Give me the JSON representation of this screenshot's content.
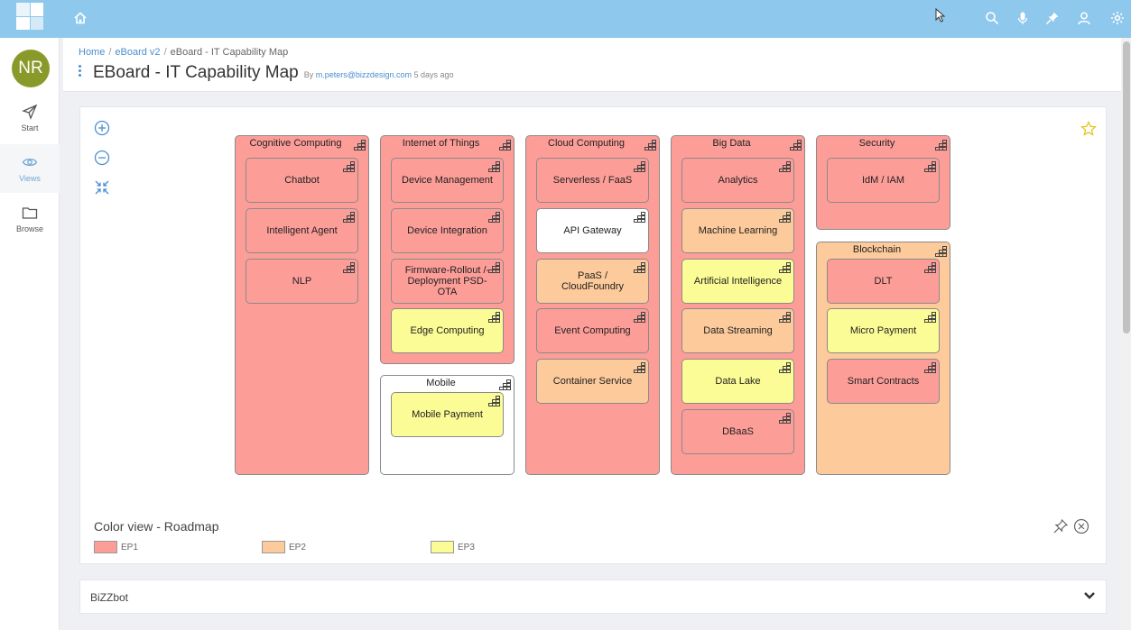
{
  "user": {
    "initials": "NR"
  },
  "nav": {
    "start": "Start",
    "views": "Views",
    "browse": "Browse"
  },
  "breadcrumb": {
    "home": "Home",
    "parent": "eBoard v2",
    "current": "eBoard - IT Capability Map"
  },
  "page": {
    "title": "EBoard - IT Capability Map",
    "by": "By",
    "author": "m.peters@bizzdesign.com",
    "time": "5 days ago"
  },
  "groups": {
    "cognitive": {
      "title": "Cognitive Computing",
      "status": "EP1",
      "items": [
        {
          "label": "Chatbot",
          "status": "EP1"
        },
        {
          "label": "Intelligent Agent",
          "status": "EP1"
        },
        {
          "label": "NLP",
          "status": "EP1"
        }
      ]
    },
    "iot": {
      "title": "Internet of Things",
      "status": "EP1",
      "items": [
        {
          "label": "Device Management",
          "status": "EP1"
        },
        {
          "label": "Device Integration",
          "status": "EP1"
        },
        {
          "label": "Firmware-Rollout /-Deployment PSD-OTA",
          "status": "EP1"
        },
        {
          "label": "Edge Computing",
          "status": "EP3"
        }
      ]
    },
    "mobile": {
      "title": "Mobile",
      "status": "none",
      "items": [
        {
          "label": "Mobile Payment",
          "status": "EP3"
        }
      ]
    },
    "cloud": {
      "title": "Cloud Computing",
      "status": "EP1",
      "items": [
        {
          "label": "Serverless / FaaS",
          "status": "EP1"
        },
        {
          "label": "API Gateway",
          "status": "none"
        },
        {
          "label": "PaaS / CloudFoundry",
          "status": "EP2"
        },
        {
          "label": "Event Computing",
          "status": "EP1"
        },
        {
          "label": "Container Service",
          "status": "EP2"
        }
      ]
    },
    "bigdata": {
      "title": "Big Data",
      "status": "EP1",
      "items": [
        {
          "label": "Analytics",
          "status": "EP1"
        },
        {
          "label": "Machine Learning",
          "status": "EP2"
        },
        {
          "label": "Artificial Intelligence",
          "status": "EP3"
        },
        {
          "label": "Data Streaming",
          "status": "EP2"
        },
        {
          "label": "Data Lake",
          "status": "EP3"
        },
        {
          "label": "DBaaS",
          "status": "EP1"
        }
      ]
    },
    "security": {
      "title": "Security",
      "status": "EP1",
      "items": [
        {
          "label": "IdM / IAM",
          "status": "EP1"
        }
      ]
    },
    "blockchain": {
      "title": "Blockchain",
      "status": "EP2",
      "items": [
        {
          "label": "DLT",
          "status": "EP1"
        },
        {
          "label": "Micro Payment",
          "status": "EP3"
        },
        {
          "label": "Smart Contracts",
          "status": "EP1"
        }
      ]
    }
  },
  "legend": {
    "title": "Color view - Roadmap",
    "items": [
      {
        "label": "EP1",
        "color": "#fd9d98"
      },
      {
        "label": "EP2",
        "color": "#fdca9b"
      },
      {
        "label": "EP3",
        "color": "#fcfc96"
      }
    ]
  },
  "bizzbot": {
    "label": "BiZZbot"
  },
  "colors": {
    "topbar": "#8ec8ec",
    "accent": "#4a8ed0",
    "avatar": "#8a9a2a",
    "EP1": "#fd9d98",
    "EP2": "#fdca9b",
    "EP3": "#fcfc96"
  },
  "icons": {
    "topbar": [
      "home-icon",
      "search-icon",
      "microphone-icon",
      "pin-icon",
      "user-icon",
      "gear-icon"
    ],
    "nav": [
      "send-icon",
      "eye-icon",
      "folder-icon"
    ],
    "zoom": [
      "zoom-in-icon",
      "zoom-out-icon",
      "fit-screen-icon"
    ],
    "capability": "capability-icon"
  }
}
